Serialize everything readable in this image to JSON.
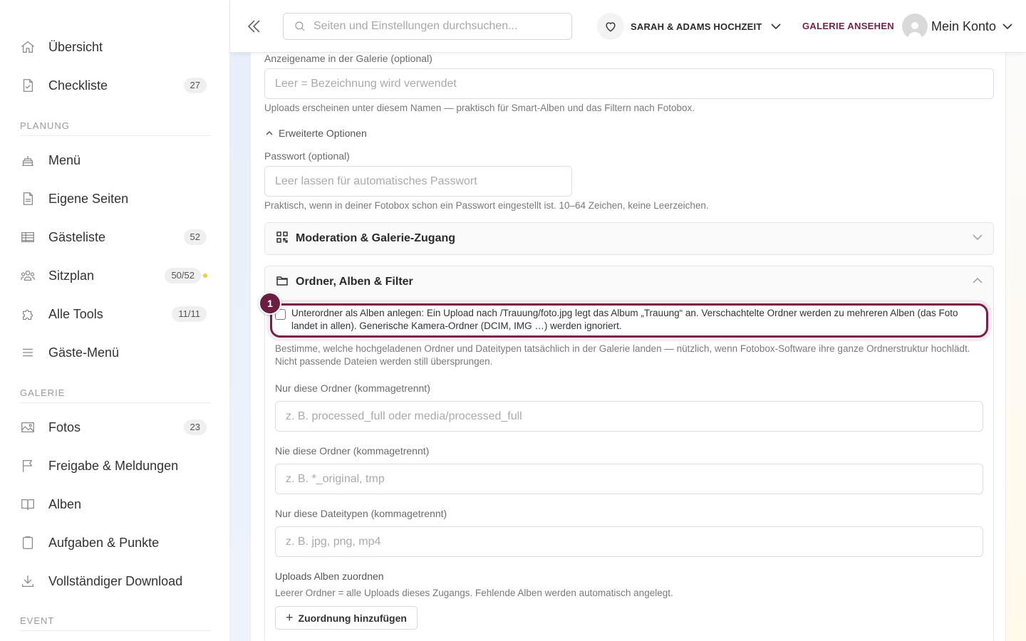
{
  "sidebar": {
    "items_top": [
      {
        "label": "Übersicht",
        "icon": "home-icon"
      },
      {
        "label": "Checkliste",
        "icon": "checklist-icon",
        "badge": "27"
      }
    ],
    "sections": [
      {
        "title": "PLANUNG"
      },
      {
        "title": "GALERIE"
      },
      {
        "title": "EVENT"
      }
    ],
    "planung": [
      {
        "label": "Menü",
        "icon": "cake-icon"
      },
      {
        "label": "Eigene Seiten",
        "icon": "page-icon"
      },
      {
        "label": "Gästeliste",
        "icon": "table-icon",
        "badge": "52"
      },
      {
        "label": "Sitzplan",
        "icon": "people-icon",
        "badge": "50/52",
        "dot": true
      },
      {
        "label": "Alle Tools",
        "icon": "puzzle-icon",
        "badge": "11/11"
      },
      {
        "label": "Gäste-Menü",
        "icon": "menu-icon"
      }
    ],
    "galerie": [
      {
        "label": "Fotos",
        "icon": "image-icon",
        "badge": "23"
      },
      {
        "label": "Freigabe & Meldungen",
        "icon": "flag-icon"
      },
      {
        "label": "Alben",
        "icon": "book-icon"
      },
      {
        "label": "Aufgaben & Punkte",
        "icon": "clipboard-icon"
      },
      {
        "label": "Vollständiger Download",
        "icon": "download-icon"
      }
    ]
  },
  "topbar": {
    "search_placeholder": "Seiten und Einstellungen durchsuchen...",
    "event_name": "SARAH & ADAMS HOCHZEIT",
    "gallery_link": "GALERIE ANSEHEN",
    "account_label": "Mein Konto",
    "accent_color": "#7a1f4a"
  },
  "form": {
    "display_name_label": "Anzeigename in der Galerie (optional)",
    "display_name_placeholder": "Leer = Bezeichnung wird verwendet",
    "display_name_hint": "Uploads erscheinen unter diesem Namen — praktisch für Smart-Alben und das Filtern nach Fotobox.",
    "advanced_toggle": "Erweiterte Optionen",
    "password_label": "Passwort (optional)",
    "password_placeholder": "Leer lassen für automatisches Passwort",
    "password_hint": "Praktisch, wenn in deiner Fotobox schon ein Passwort eingestellt ist. 10–64 Zeichen, keine Leerzeichen.",
    "moderation_title": "Moderation & Galerie-Zugang",
    "folders_title": "Ordner, Alben & Filter",
    "subfolder_checkbox_text": "Unterordner als Alben anlegen: Ein Upload nach /Trauung/foto.jpg legt das Album „Trauung“ an. Verschachtelte Ordner werden zu mehreren Alben (das Foto landet in allen). Generische Kamera-Ordner (DCIM, IMG …) werden ignoriert.",
    "step_number": "1",
    "folders_intro": "Bestimme, welche hochgeladenen Ordner und Dateitypen tatsächlich in der Galerie landen — nützlich, wenn Fotobox-Software ihre ganze Ordnerstruktur hochlädt. Nicht passende Dateien werden still übersprungen.",
    "only_folders_label": "Nur diese Ordner (kommagetrennt)",
    "only_folders_placeholder": "z. B. processed_full oder media/processed_full",
    "never_folders_label": "Nie diese Ordner (kommagetrennt)",
    "never_folders_placeholder": "z. B. *_original, tmp",
    "only_types_label": "Nur diese Dateitypen (kommagetrennt)",
    "only_types_placeholder": "z. B. jpg, png, mp4",
    "assign_albums_label": "Uploads Alben zuordnen",
    "assign_albums_hint": "Leerer Ordner = alle Uploads dieses Zugangs. Fehlende Alben werden automatisch angelegt.",
    "add_mapping_button": "Zuordnung hinzufügen"
  }
}
